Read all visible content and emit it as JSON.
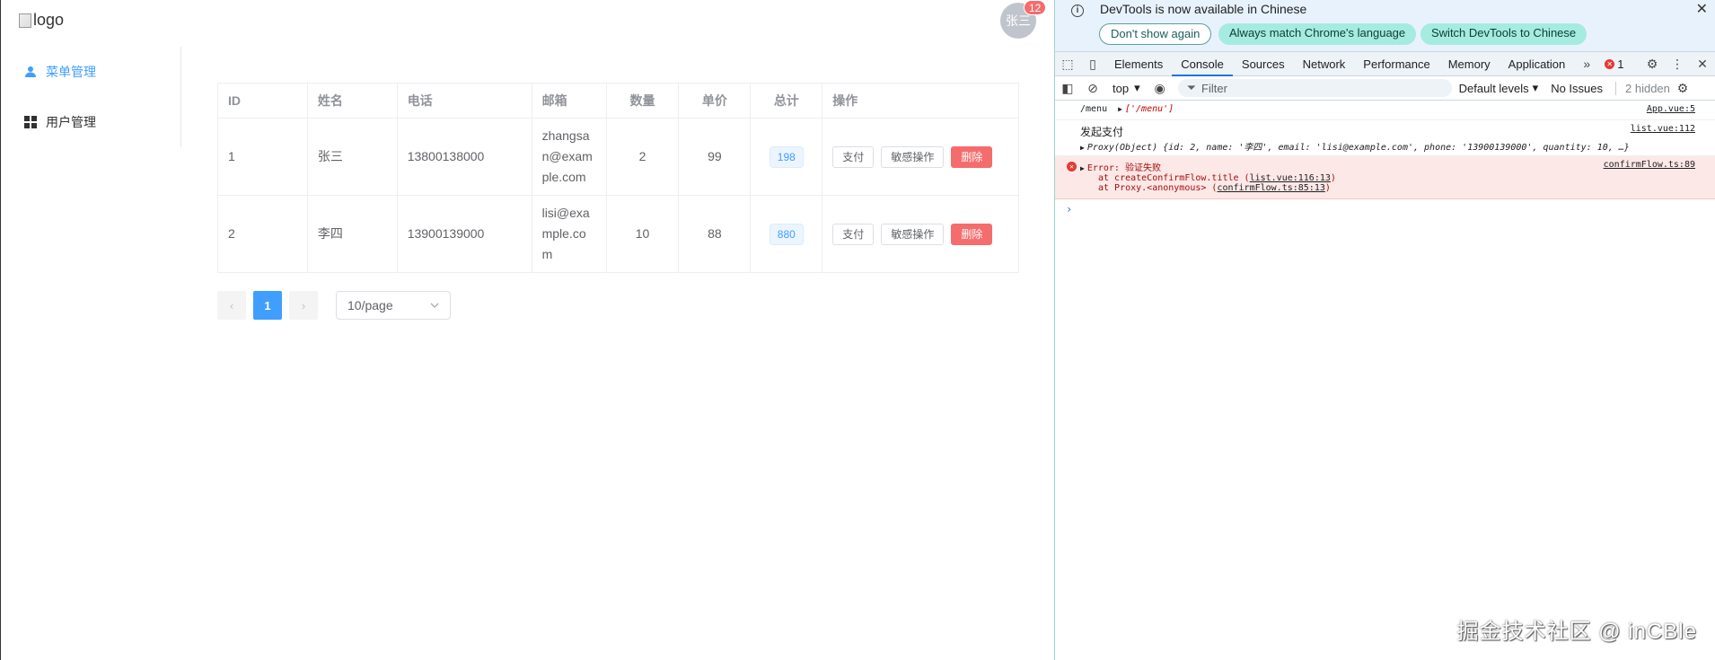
{
  "app": {
    "logo_alt": "logo",
    "user_name": "张三",
    "notification_count": "12",
    "menu": [
      {
        "label": "菜单管理",
        "icon": "user-icon",
        "active": true
      },
      {
        "label": "用户管理",
        "icon": "grid-icon",
        "active": false
      }
    ],
    "table": {
      "headers": [
        "ID",
        "姓名",
        "电话",
        "邮箱",
        "数量",
        "单价",
        "总计",
        "操作"
      ],
      "rows": [
        {
          "id": "1",
          "name": "张三",
          "phone": "13800138000",
          "email": "zhangsan@example.com",
          "email_lines": [
            "zhangsa",
            "n@exam",
            "ple.com"
          ],
          "quantity": "2",
          "price": "99",
          "total": "198"
        },
        {
          "id": "2",
          "name": "李四",
          "phone": "13900139000",
          "email": "lisi@example.com",
          "email_lines": [
            "lisi@exa",
            "mple.co",
            "m"
          ],
          "quantity": "10",
          "price": "88",
          "total": "880"
        }
      ],
      "actions": {
        "pay": "支付",
        "sensitive": "敏感操作",
        "delete": "删除"
      }
    },
    "pagination": {
      "prev": "‹",
      "current_page": "1",
      "next": "›",
      "page_size": "10/page"
    }
  },
  "devtools": {
    "infobar": {
      "message": "DevTools is now available in Chinese",
      "dont_show": "Don't show again",
      "match_language": "Always match Chrome's language",
      "switch_chinese": "Switch DevTools to Chinese"
    },
    "tabs": [
      "Elements",
      "Console",
      "Sources",
      "Network",
      "Performance",
      "Memory",
      "Application"
    ],
    "active_tab": "Console",
    "error_count": "1",
    "toolbar": {
      "context": "top",
      "filter_placeholder": "Filter",
      "levels": "Default levels",
      "issues": "No Issues",
      "hidden": "2 hidden"
    },
    "console": [
      {
        "type": "log",
        "prefix": "/menu",
        "value": "['/menu']",
        "source": "App.vue:5"
      },
      {
        "type": "log",
        "prefix": "发起支付",
        "value": "Proxy(Object)  {id: 2, name: '李四', email: 'lisi@example.com', phone: '13900139000', quantity: 10,  …}",
        "source": "list.vue:112"
      },
      {
        "type": "error",
        "message": "Error: 验证失败",
        "stack": [
          {
            "text": "at createConfirmFlow.title (",
            "link": "list.vue:116:13",
            "after": ")"
          },
          {
            "text": "at Proxy.<anonymous> (",
            "link": "confirmFlow.ts:85:13",
            "after": ")"
          }
        ],
        "source": "confirmFlow.ts:89"
      }
    ],
    "prompt": "›"
  },
  "watermark": "掘金技术社区 @ inCBle"
}
